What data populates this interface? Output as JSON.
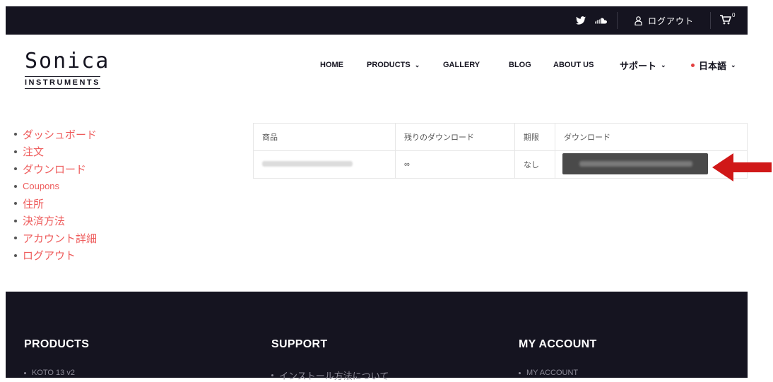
{
  "topbar": {
    "twitter_icon": "twitter-icon",
    "soundcloud_icon": "soundcloud-icon",
    "user_icon": "user-icon",
    "logout_label": "ログアウト",
    "cart_icon": "cart-icon",
    "cart_count": "0"
  },
  "logo": {
    "brand": "Sonica",
    "sub": "INSTRUMENTS"
  },
  "nav": {
    "home": "HOME",
    "products": "PRODUCTS",
    "gallery": "GALLERY",
    "blog": "BLOG",
    "about": "ABOUT US",
    "support": "サポート",
    "language": "日本語"
  },
  "sidebar": {
    "items": [
      {
        "label": "ダッシュボード"
      },
      {
        "label": "注文"
      },
      {
        "label": "ダウンロード"
      },
      {
        "label": "Coupons"
      },
      {
        "label": "住所"
      },
      {
        "label": "決済方法"
      },
      {
        "label": "アカウント詳細"
      },
      {
        "label": "ログアウト"
      }
    ]
  },
  "downloads": {
    "headers": [
      "商品",
      "残りのダウンロード",
      "期限",
      "ダウンロード"
    ],
    "row": {
      "remaining": "∞",
      "expires": "なし"
    }
  },
  "footer": {
    "products": {
      "title": "PRODUCTS",
      "item": "KOTO 13 v2"
    },
    "support": {
      "title": "SUPPORT",
      "item": "インストール方法について"
    },
    "account": {
      "title": "MY ACCOUNT",
      "item": "MY ACCOUNT"
    }
  },
  "colors": {
    "dark": "#151420",
    "accent_red": "#ee5b5b",
    "arrow_red": "#d01818"
  }
}
